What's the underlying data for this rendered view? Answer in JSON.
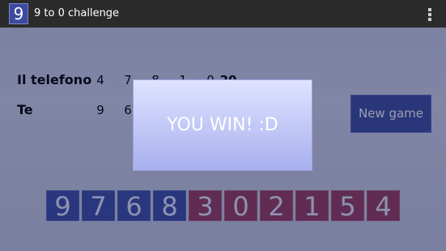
{
  "actionbar": {
    "app_icon_digit": "9",
    "title": "9 to 0 challenge",
    "overflow_icon": "vertical-dots-icon"
  },
  "game": {
    "rows": [
      {
        "label": "Il telefono",
        "digits": [
          "4",
          "7",
          "8",
          "1",
          "0"
        ],
        "score": "20"
      },
      {
        "label": "Te",
        "digits": [
          "9",
          "6"
        ]
      }
    ],
    "new_game_label": "New game"
  },
  "tiles": [
    {
      "digit": "9",
      "color": "blue"
    },
    {
      "digit": "7",
      "color": "blue"
    },
    {
      "digit": "6",
      "color": "blue"
    },
    {
      "digit": "8",
      "color": "blue"
    },
    {
      "digit": "3",
      "color": "red"
    },
    {
      "digit": "0",
      "color": "red"
    },
    {
      "digit": "2",
      "color": "red"
    },
    {
      "digit": "1",
      "color": "red"
    },
    {
      "digit": "5",
      "color": "red"
    },
    {
      "digit": "4",
      "color": "red"
    }
  ],
  "dialog": {
    "message": "YOU WIN! :D"
  },
  "colors": {
    "actionbar": "#2b2b2b",
    "accent_blue": "#3f4fa6",
    "accent_red": "#9c3d5e"
  }
}
